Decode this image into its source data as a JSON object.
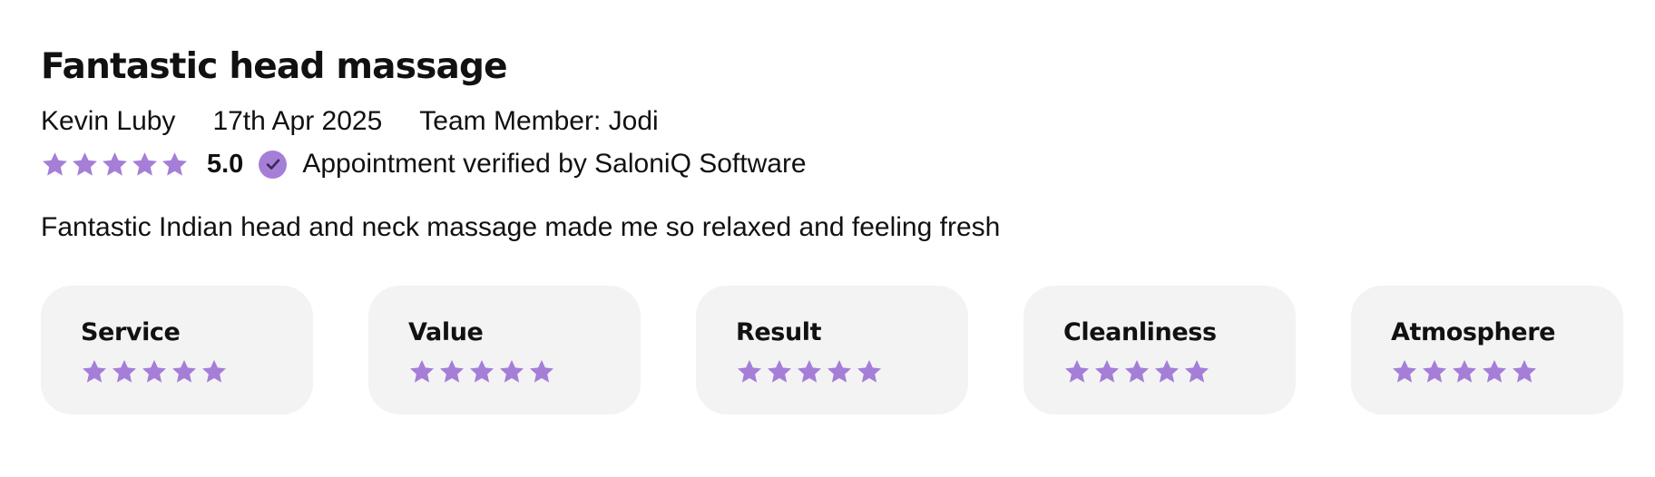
{
  "review": {
    "title": "Fantastic head massage",
    "author": "Kevin Luby",
    "date": "17th Apr 2025",
    "team_member": "Team Member: Jodi",
    "rating": 5,
    "rating_text": "5.0",
    "verified_text": "Appointment verified by SaloniQ Software",
    "body": "Fantastic Indian head and neck massage made me so relaxed and feeling fresh"
  },
  "categories": [
    {
      "label": "Service",
      "rating": 5
    },
    {
      "label": "Value",
      "rating": 5
    },
    {
      "label": "Result",
      "rating": 5
    },
    {
      "label": "Cleanliness",
      "rating": 5
    },
    {
      "label": "Atmosphere",
      "rating": 5
    }
  ],
  "colors": {
    "star": "#a57ed8",
    "card_background": "#f3f3f3",
    "verified_badge": "#a57ed8",
    "text": "#111111"
  },
  "icons": {
    "star": "star-icon",
    "verified": "check-circle-icon"
  }
}
